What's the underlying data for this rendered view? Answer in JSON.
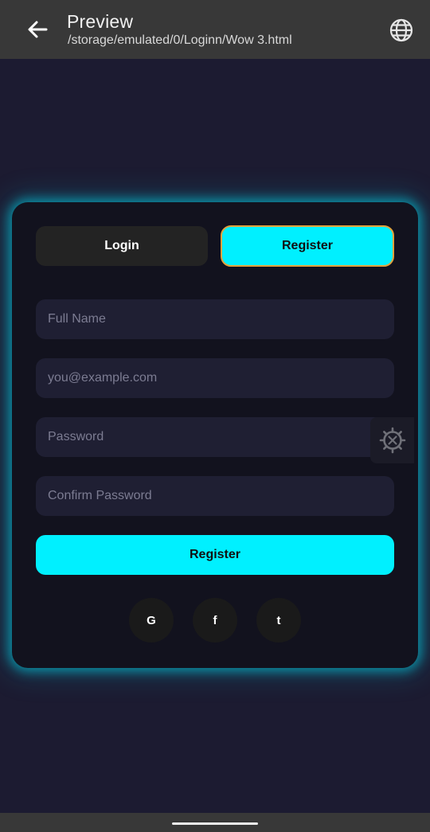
{
  "appbar": {
    "title": "Preview",
    "path": "/storage/emulated/0/Loginn/Wow 3.html",
    "back_icon": "arrow-left-icon",
    "globe_icon": "globe-icon"
  },
  "tabs": {
    "login_label": "Login",
    "register_label": "Register",
    "active": "Register"
  },
  "form": {
    "full_name_placeholder": "Full Name",
    "email_placeholder": "you@example.com",
    "password_placeholder": "Password",
    "confirm_password_placeholder": "Confirm Password",
    "submit_label": "Register"
  },
  "social": {
    "google": "G",
    "facebook": "f",
    "twitter": "t"
  },
  "floating": {
    "icon": "settings-tools-icon"
  },
  "colors": {
    "accent": "#00f0ff",
    "background": "#1c1b31",
    "card": "#12121e",
    "appbar": "#383838"
  }
}
